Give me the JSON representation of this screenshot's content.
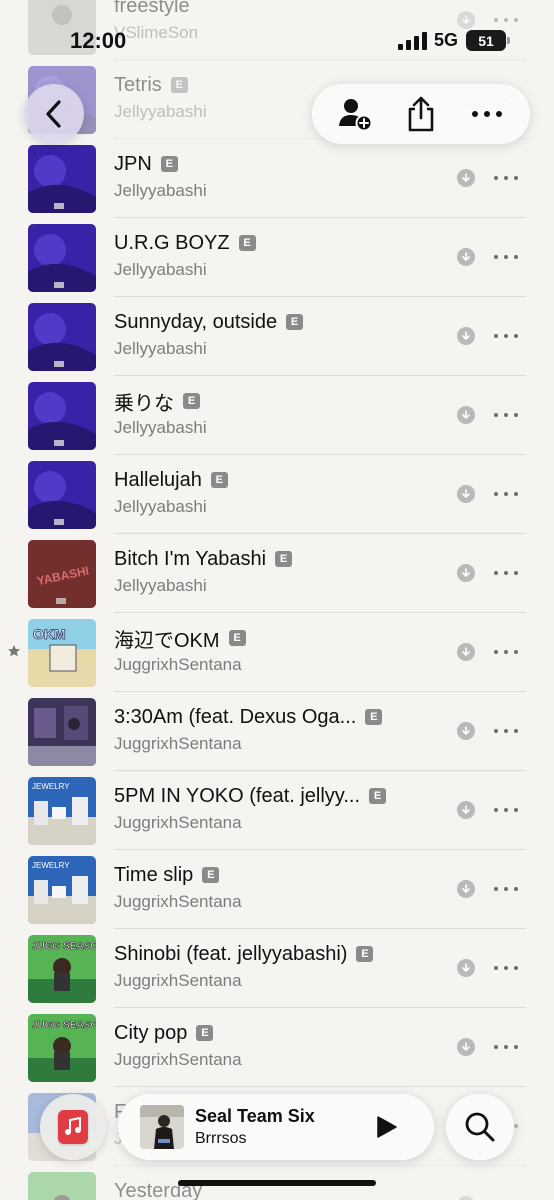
{
  "status_bar": {
    "time": "12:00",
    "network": "5G",
    "battery": "51"
  },
  "top_bar": {
    "back_icon": "chevron-left-icon",
    "actions": [
      "add-person-icon",
      "share-icon",
      "more-icon"
    ]
  },
  "tracks": [
    {
      "title": "freestyle",
      "artist": "VSlimeSon",
      "explicit": false,
      "art": "gray",
      "faded": true
    },
    {
      "title": "Tetris",
      "artist": "Jellyyabashi",
      "explicit": true,
      "art": "purple",
      "faded": true
    },
    {
      "title": "JPN",
      "artist": "Jellyyabashi",
      "explicit": true,
      "art": "purple"
    },
    {
      "title": "U.R.G BOYZ",
      "artist": "Jellyyabashi",
      "explicit": true,
      "art": "purple"
    },
    {
      "title": "Sunnyday, outside",
      "artist": "Jellyyabashi",
      "explicit": true,
      "art": "purple"
    },
    {
      "title": "乗りな",
      "artist": "Jellyyabashi",
      "explicit": true,
      "art": "purple"
    },
    {
      "title": "Hallelujah",
      "artist": "Jellyyabashi",
      "explicit": true,
      "art": "purple"
    },
    {
      "title": "Bitch I'm Yabashi",
      "artist": "Jellyyabashi",
      "explicit": true,
      "art": "red",
      "art_text": "YABASHI"
    },
    {
      "title": "海辺でOKM",
      "artist": "JuggrixhSentana",
      "explicit": true,
      "art": "beach",
      "art_text": "OKM",
      "starred": true
    },
    {
      "title": "3:30Am (feat. Dexus Oga...",
      "artist": "JuggrixhSentana",
      "explicit": true,
      "art": "night"
    },
    {
      "title": "5PM IN YOKO (feat. jellyy...",
      "artist": "JuggrixhSentana",
      "explicit": true,
      "art": "jewelry",
      "art_text": "JEWELRY"
    },
    {
      "title": "Time slip",
      "artist": "JuggrixhSentana",
      "explicit": true,
      "art": "jewelry",
      "art_text": "JEWELRY"
    },
    {
      "title": "Shinobi (feat. jellyyabashi)",
      "artist": "JuggrixhSentana",
      "explicit": true,
      "art": "green",
      "art_text": "JUGG SEASON"
    },
    {
      "title": "City pop",
      "artist": "JuggrixhSentana",
      "explicit": true,
      "art": "green",
      "art_text": "JUGG SEASON"
    },
    {
      "title": "F",
      "artist": "J",
      "explicit": false,
      "art": "blue",
      "faded": true
    },
    {
      "title": "Yesterday",
      "artist": "",
      "explicit": false,
      "art": "green",
      "faded": true
    }
  ],
  "explicit_label": "E",
  "now_playing": {
    "title": "Seal Team Six",
    "artist": "Brrrsos"
  },
  "colors": {
    "accent": "#e03c43",
    "back_button": "#dcd6ec",
    "background": "#f5f4f1"
  }
}
